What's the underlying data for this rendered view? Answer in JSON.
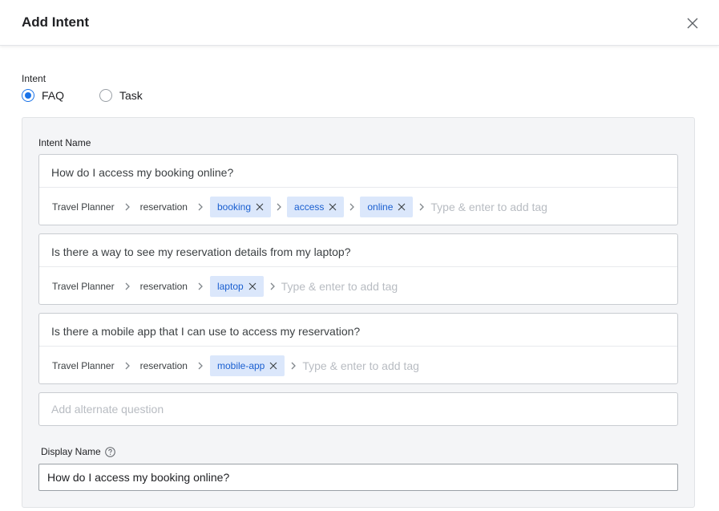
{
  "dialog": {
    "title": "Add Intent"
  },
  "intent_type": {
    "label": "Intent",
    "options": [
      {
        "label": "FAQ",
        "selected": true
      },
      {
        "label": "Task",
        "selected": false
      }
    ]
  },
  "intent_name": {
    "label": "Intent Name",
    "tag_placeholder": "Type & enter to add tag",
    "questions": [
      {
        "text": "How do I access my booking online?",
        "crumbs": [
          "Travel Planner",
          "reservation"
        ],
        "tags": [
          "booking",
          "access",
          "online"
        ]
      },
      {
        "text": "Is there a way to see my reservation details from my laptop?",
        "crumbs": [
          "Travel Planner",
          "reservation"
        ],
        "tags": [
          "laptop"
        ]
      },
      {
        "text": "Is there a mobile app that I can use to access my reservation?",
        "crumbs": [
          "Travel Planner",
          "reservation"
        ],
        "tags": [
          "mobile-app"
        ]
      }
    ],
    "alternate_placeholder": "Add alternate question"
  },
  "display_name": {
    "label": "Display Name",
    "value": "How do I access my booking online?"
  },
  "icons": {
    "close": "close-icon",
    "help": "help-circle-icon",
    "chevron": "chevron-right-icon",
    "tag_remove": "close-icon"
  },
  "colors": {
    "accent": "#1a73e8",
    "tag_bg": "#dbe7fb",
    "tag_text": "#1a5fd0",
    "panel_bg": "#f4f5f7"
  }
}
